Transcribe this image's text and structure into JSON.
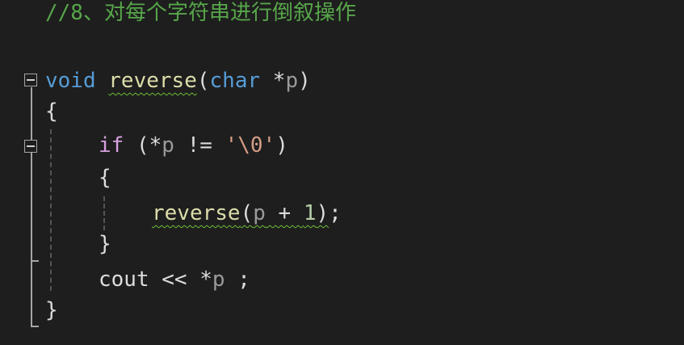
{
  "code": {
    "comment": "//8、对每个字符串进行倒叙操作",
    "func_line": {
      "kw_void": "void",
      "fn_name": "reverse",
      "open_paren": "(",
      "kw_char": "char",
      "ptr": " *",
      "param": "p",
      "close_paren": ")"
    },
    "open_brace": "{",
    "if_line": {
      "kw_if": "if",
      "pre": " (*",
      "var": "p",
      "op": " != ",
      "literal": "'\\0'",
      "close": ")"
    },
    "inner_open_brace": "{",
    "call_line": {
      "fn_name": "reverse",
      "open": "(",
      "var": "p",
      "op": " + ",
      "num": "1",
      "close": ")",
      "semi": ";"
    },
    "inner_close_brace": "}",
    "cout_line": {
      "name": "cout",
      "op": " << *",
      "var": "p",
      "semi": " ;"
    },
    "close_brace": "}"
  },
  "colors": {
    "background": "#1e1e1e",
    "comment": "#57a64a",
    "keyword": "#569cd6",
    "control_keyword": "#d8a0df",
    "function": "#dcdcaa",
    "string": "#d69d85",
    "number": "#b5cea8"
  }
}
